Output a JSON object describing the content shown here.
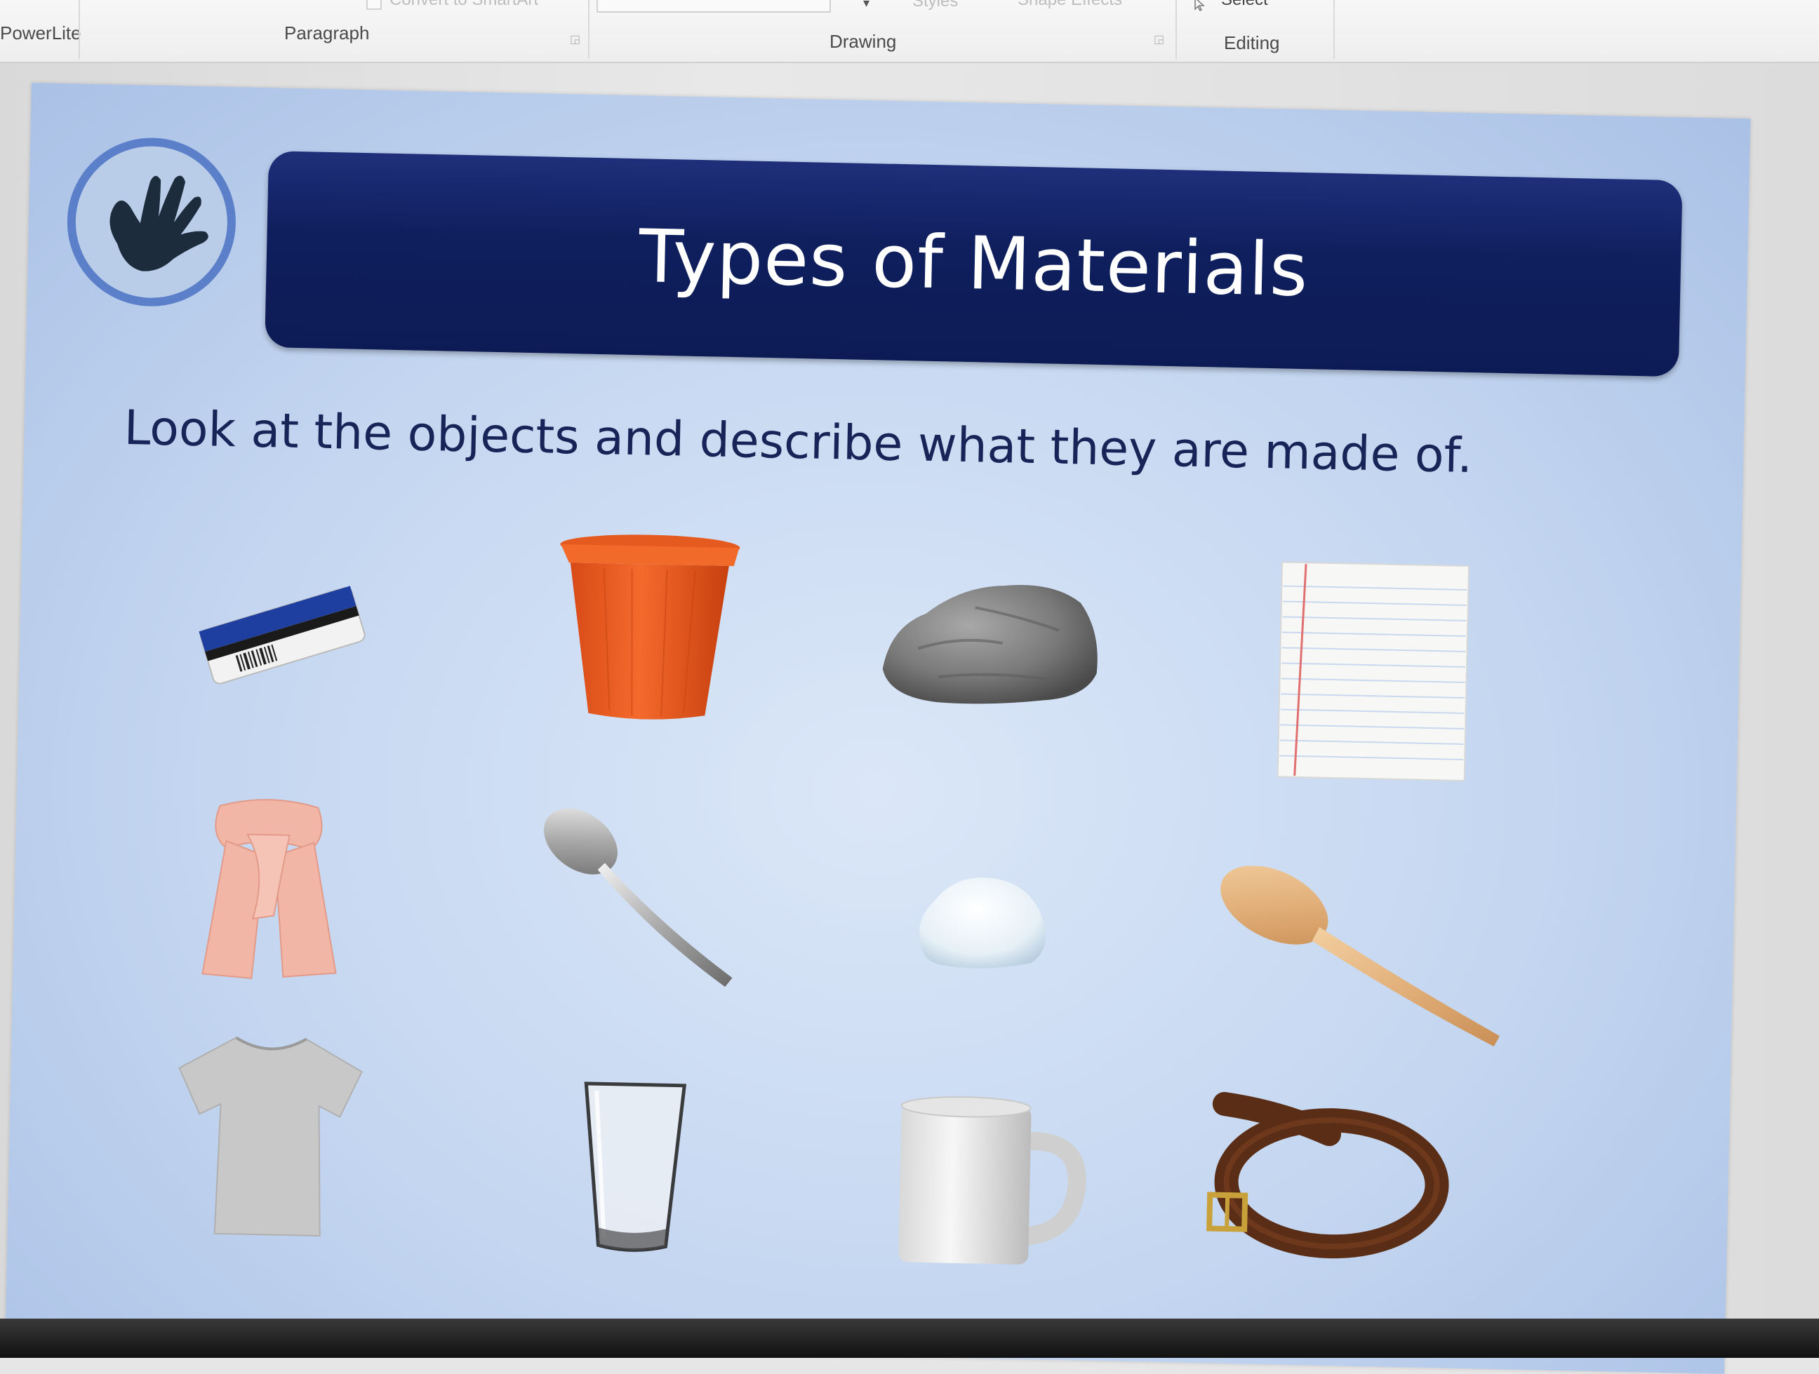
{
  "ribbon": {
    "groups": [
      {
        "label": "PowerLite"
      },
      {
        "label": "Paragraph"
      },
      {
        "label": "Drawing"
      },
      {
        "label": "Editing"
      }
    ],
    "faded_items": {
      "convert_smartart": "Convert to SmartArt",
      "styles": "Styles",
      "shape_effects": "Shape Effects",
      "select": "Select"
    }
  },
  "slide": {
    "title": "Types of Materials",
    "instruction": "Look at the objects and describe what they are made of.",
    "logo_icon": "handprint-icon",
    "objects": [
      {
        "icon": "eraser-image"
      },
      {
        "icon": "plastic-cup-image"
      },
      {
        "icon": "rock-image"
      },
      {
        "icon": "paper-sheet-image"
      },
      {
        "icon": "scarf-image"
      },
      {
        "icon": "metal-spoon-image"
      },
      {
        "icon": "cotton-wool-image"
      },
      {
        "icon": "wooden-spoon-image"
      },
      {
        "icon": "t-shirt-image"
      },
      {
        "icon": "drinking-glass-image"
      },
      {
        "icon": "mug-image"
      },
      {
        "icon": "belt-image"
      }
    ]
  },
  "colors": {
    "title_bar": "#0f1f5e",
    "title_text": "#ffffff",
    "instruction_text": "#172457",
    "slide_bg": "#c4d6f0",
    "logo_ring": "#5b7fc9"
  }
}
